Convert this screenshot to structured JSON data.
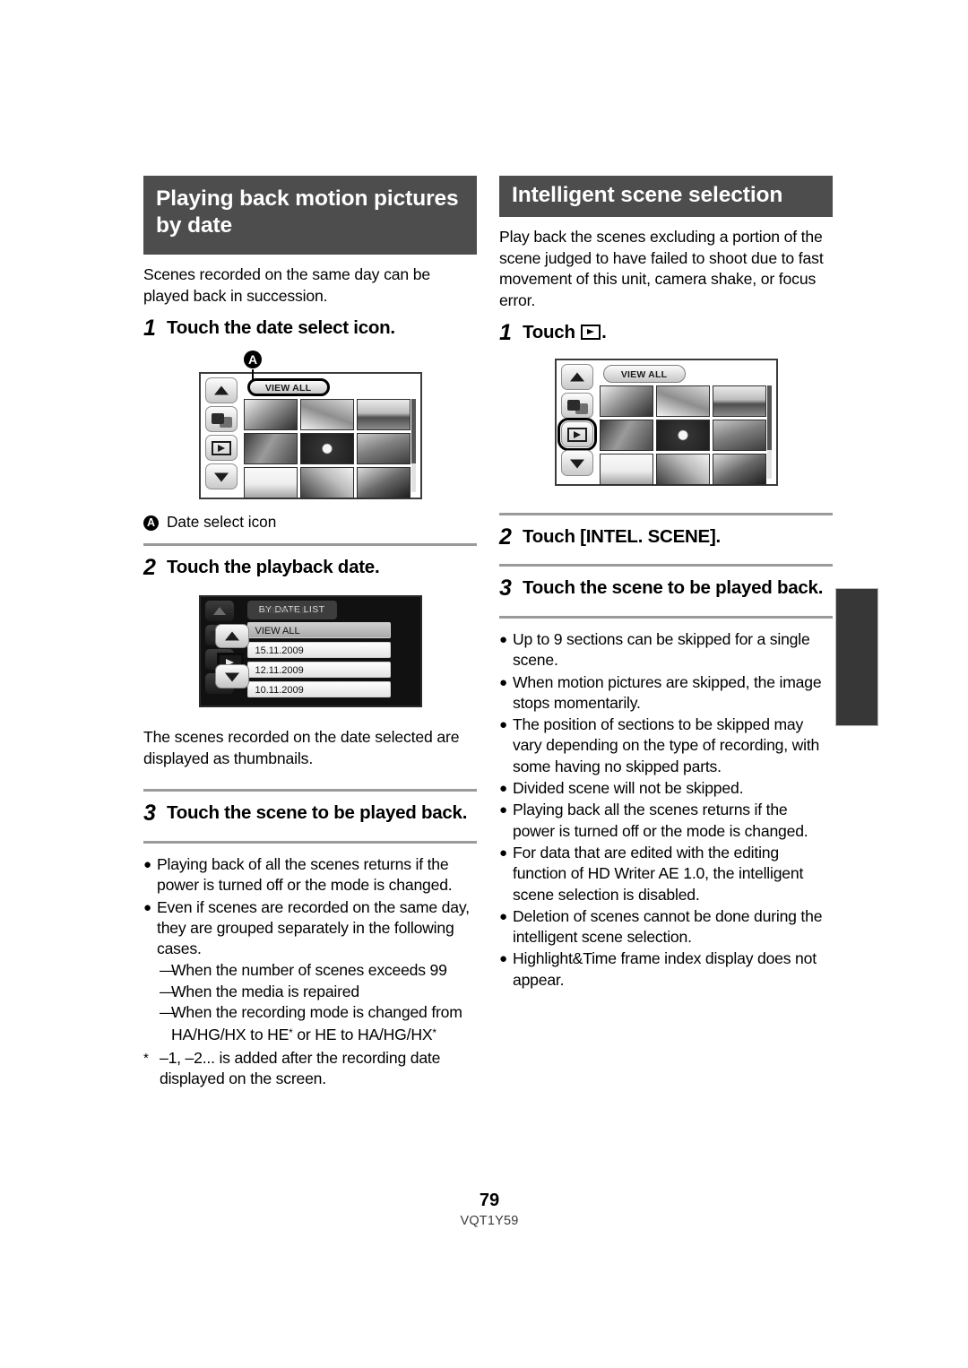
{
  "page": {
    "number": "79",
    "doc_code": "VQT1Y59"
  },
  "left": {
    "heading": "Playing back motion pictures by date",
    "intro": "Scenes recorded on the same day can be played back in succession.",
    "step1": {
      "num": "1",
      "text": "Touch the date select icon."
    },
    "screen1": {
      "callout_letter": "A",
      "view_all_label": "VIEW ALL",
      "rail_icons": [
        "up-arrow-icon",
        "media-select-icon",
        "play-mode-icon",
        "down-arrow-icon"
      ]
    },
    "callout_a": {
      "letter": "A",
      "text": "Date select icon"
    },
    "step2": {
      "num": "2",
      "text": "Touch the playback date."
    },
    "screen2": {
      "ghost_label": "VIEW ALL",
      "title": "BY DATE LIST",
      "rows": [
        "VIEW ALL",
        "15.11.2009",
        "12.11.2009",
        "10.11.2009"
      ]
    },
    "after_screen2": "The scenes recorded on the date selected are displayed as thumbnails.",
    "step3": {
      "num": "3",
      "text": "Touch the scene to be played back."
    },
    "bullets": [
      "Playing back of all the scenes returns if the power is turned off or the mode is changed.",
      "Even if scenes are recorded on the same day, they are grouped separately in the following cases."
    ],
    "dashes": [
      "When the number of scenes exceeds 99",
      "When the media is repaired",
      "When the recording mode is changed from HA/HG/HX to HE"
    ],
    "dash3_tail": "or HE to HA/HG/HX",
    "footnote": "–1, –2... is added after the recording date displayed on the screen."
  },
  "right": {
    "heading": "Intelligent scene selection",
    "intro": "Play back the scenes excluding a portion of the scene judged to have failed to shoot due to fast movement of this unit, camera shake, or focus error.",
    "step1": {
      "num": "1",
      "text_before": "Touch",
      "icon": "play-icon",
      "text_after": "."
    },
    "screen1": {
      "view_all_label": "VIEW ALL",
      "rail_icons": [
        "up-arrow-icon",
        "media-select-icon",
        "play-mode-icon",
        "down-arrow-icon"
      ],
      "highlighted_icon": "play-mode-icon"
    },
    "step2": {
      "num": "2",
      "text": "Touch [INTEL. SCENE]."
    },
    "step3": {
      "num": "3",
      "text": "Touch the scene to be played back."
    },
    "bullets": [
      "Up to 9 sections can be skipped for a single scene.",
      "When motion pictures are skipped, the image stops momentarily.",
      "The position of sections to be skipped may vary depending on the type of recording, with some having no skipped parts.",
      "Divided scene will not be skipped.",
      "Playing back all the scenes returns if the power is turned off or the mode is changed.",
      "For data that are edited with the editing function of HD Writer AE 1.0, the intelligent scene selection is disabled.",
      "Deletion of scenes cannot be done during the intelligent scene selection.",
      "Highlight&Time frame index display does not appear."
    ]
  },
  "colors": {
    "heading_bar": "#4d4d4d",
    "rule": "#9a9a9a",
    "edge_tab": "#373737"
  }
}
